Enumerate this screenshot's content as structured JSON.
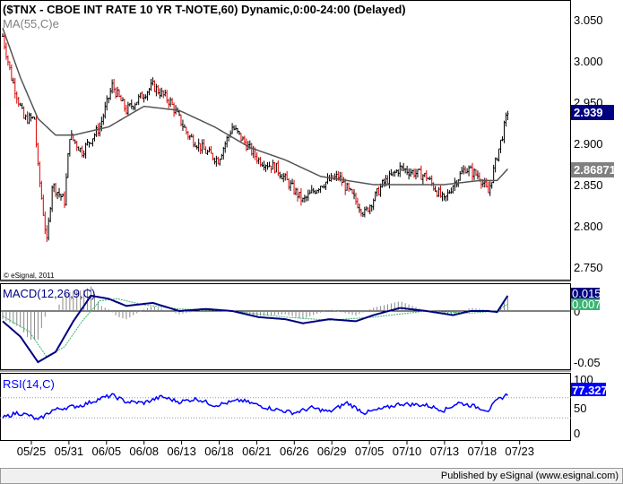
{
  "title": "($TNX - CBOE INT RATE 10 YR T-NOTE,60) Dynamic,0:00-24:00 (Delayed)",
  "ma_label": "MA(55,C)e",
  "copyright": "© eSignal, 2011",
  "macd_label": "MACD(12,26,9,C)",
  "rsi_label": "RSI(14,C)",
  "footer": "Published by eSignal (www.esignal.com)",
  "colors": {
    "macd": "#000080",
    "signal": "#3cb371",
    "hist": "#c000c0",
    "rsi": "#0000ff",
    "ma": "#555555",
    "price_tag": "#000080",
    "ma_tag": "#808080"
  },
  "chart_data": [
    {
      "type": "ohlc",
      "name": "price",
      "title": "($TNX - CBOE INT RATE 10 YR T-NOTE,60)",
      "ylim": [
        2.73,
        3.07
      ],
      "yticks": [
        "3.050",
        "3.000",
        "2.950",
        "2.900",
        "2.850",
        "2.800",
        "2.750"
      ],
      "last_price": "2.939",
      "ma_last": "2.86871",
      "close_anchors": [
        [
          0,
          3.03
        ],
        [
          5,
          2.98
        ],
        [
          12,
          2.93
        ],
        [
          18,
          2.93
        ],
        [
          20,
          2.87
        ],
        [
          25,
          2.78
        ],
        [
          28,
          2.85
        ],
        [
          35,
          2.83
        ],
        [
          38,
          2.91
        ],
        [
          45,
          2.89
        ],
        [
          55,
          2.92
        ],
        [
          62,
          2.97
        ],
        [
          70,
          2.94
        ],
        [
          85,
          2.97
        ],
        [
          95,
          2.95
        ],
        [
          105,
          2.91
        ],
        [
          115,
          2.89
        ],
        [
          122,
          2.88
        ],
        [
          130,
          2.92
        ],
        [
          145,
          2.88
        ],
        [
          155,
          2.87
        ],
        [
          170,
          2.83
        ],
        [
          180,
          2.85
        ],
        [
          190,
          2.86
        ],
        [
          200,
          2.83
        ],
        [
          205,
          2.815
        ],
        [
          215,
          2.85
        ],
        [
          225,
          2.87
        ],
        [
          240,
          2.86
        ],
        [
          250,
          2.83
        ],
        [
          255,
          2.85
        ],
        [
          262,
          2.87
        ],
        [
          270,
          2.86
        ],
        [
          275,
          2.84
        ],
        [
          280,
          2.885
        ],
        [
          283,
          2.91
        ],
        [
          286,
          2.939
        ]
      ],
      "ma_anchors": [
        [
          0,
          3.04
        ],
        [
          10,
          2.98
        ],
        [
          20,
          2.93
        ],
        [
          30,
          2.91
        ],
        [
          40,
          2.91
        ],
        [
          60,
          2.92
        ],
        [
          80,
          2.945
        ],
        [
          100,
          2.94
        ],
        [
          120,
          2.92
        ],
        [
          140,
          2.895
        ],
        [
          160,
          2.88
        ],
        [
          180,
          2.86
        ],
        [
          195,
          2.855
        ],
        [
          210,
          2.85
        ],
        [
          230,
          2.85
        ],
        [
          250,
          2.85
        ],
        [
          270,
          2.855
        ],
        [
          280,
          2.855
        ],
        [
          286,
          2.869
        ]
      ]
    },
    {
      "type": "line",
      "name": "MACD(12,26,9,C)",
      "ylim": [
        -0.058,
        0.022
      ],
      "yticks": [
        "0",
        "-0.05"
      ],
      "macd_last": "0.015",
      "signal_last": "0.007",
      "macd_anchors": [
        [
          0,
          -0.01
        ],
        [
          10,
          -0.025
        ],
        [
          20,
          -0.05
        ],
        [
          30,
          -0.04
        ],
        [
          40,
          -0.01
        ],
        [
          50,
          0.015
        ],
        [
          60,
          0.012
        ],
        [
          70,
          0.005
        ],
        [
          85,
          0.008
        ],
        [
          100,
          0.0
        ],
        [
          115,
          0.002
        ],
        [
          130,
          0.0
        ],
        [
          145,
          -0.006
        ],
        [
          160,
          -0.008
        ],
        [
          170,
          -0.012
        ],
        [
          185,
          -0.008
        ],
        [
          200,
          -0.01
        ],
        [
          210,
          -0.004
        ],
        [
          225,
          0.003
        ],
        [
          240,
          0.0
        ],
        [
          255,
          -0.004
        ],
        [
          265,
          0.0
        ],
        [
          275,
          0.0
        ],
        [
          280,
          -0.001
        ],
        [
          286,
          0.015
        ]
      ],
      "signal_anchors": [
        [
          0,
          -0.005
        ],
        [
          15,
          -0.02
        ],
        [
          25,
          -0.045
        ],
        [
          35,
          -0.035
        ],
        [
          45,
          -0.01
        ],
        [
          55,
          0.01
        ],
        [
          65,
          0.012
        ],
        [
          80,
          0.006
        ],
        [
          100,
          0.002
        ],
        [
          130,
          0.0
        ],
        [
          160,
          -0.006
        ],
        [
          185,
          -0.009
        ],
        [
          210,
          -0.006
        ],
        [
          240,
          0.0
        ],
        [
          265,
          -0.002
        ],
        [
          280,
          0.0
        ],
        [
          286,
          0.007
        ]
      ]
    },
    {
      "type": "line",
      "name": "RSI(14,C)",
      "ylim": [
        0,
        100
      ],
      "yticks": [
        "100",
        "50",
        "0"
      ],
      "rsi_last": "77.327",
      "rsi_anchors": [
        [
          0,
          30
        ],
        [
          8,
          40
        ],
        [
          15,
          35
        ],
        [
          20,
          25
        ],
        [
          28,
          45
        ],
        [
          35,
          50
        ],
        [
          45,
          55
        ],
        [
          55,
          68
        ],
        [
          62,
          75
        ],
        [
          70,
          62
        ],
        [
          80,
          60
        ],
        [
          90,
          72
        ],
        [
          100,
          62
        ],
        [
          110,
          68
        ],
        [
          120,
          55
        ],
        [
          135,
          65
        ],
        [
          150,
          50
        ],
        [
          165,
          40
        ],
        [
          175,
          50
        ],
        [
          185,
          42
        ],
        [
          195,
          60
        ],
        [
          205,
          40
        ],
        [
          215,
          48
        ],
        [
          225,
          58
        ],
        [
          240,
          55
        ],
        [
          250,
          45
        ],
        [
          258,
          60
        ],
        [
          265,
          55
        ],
        [
          275,
          45
        ],
        [
          280,
          65
        ],
        [
          286,
          77
        ]
      ]
    },
    {
      "type": "axis",
      "xticks": [
        "05/25",
        "05/31",
        "06/05",
        "06/08",
        "06/13",
        "06/18",
        "06/21",
        "06/26",
        "06/29",
        "07/05",
        "07/10",
        "07/13",
        "07/18",
        "07/23"
      ]
    }
  ]
}
